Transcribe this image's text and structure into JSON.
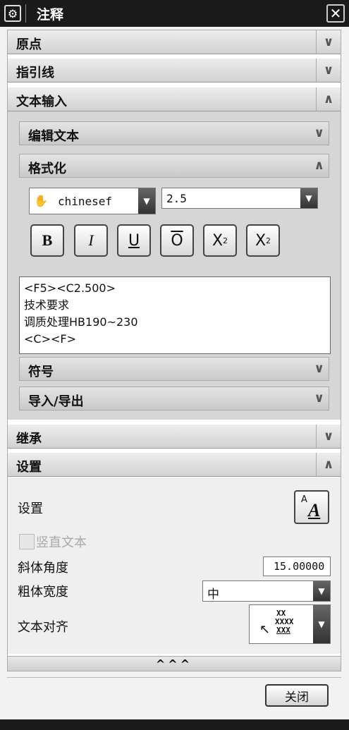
{
  "window": {
    "title": "注释",
    "close_glyph": "✕"
  },
  "sections": {
    "origin": "原点",
    "leader": "指引线",
    "text_input": "文本输入",
    "inherit": "继承",
    "settings": "设置"
  },
  "text_input": {
    "edit_text": "编辑文本",
    "format": "格式化",
    "symbols": "符号",
    "import_export": "导入/导出",
    "font_name": "chinesef",
    "font_size": "2.5",
    "format_buttons": {
      "bold": "B",
      "italic": "I",
      "underline": "U",
      "overline": "O",
      "superscript": "X",
      "superscript_mark": "2",
      "subscript": "X",
      "subscript_mark": "2"
    },
    "editor_lines": [
      "<F5><C2.500>",
      "技术要求",
      "调质处理HB190~230",
      "<C><F>"
    ]
  },
  "settings": {
    "label": "设置",
    "vertical_text": "竖直文本",
    "slant_angle_label": "斜体角度",
    "slant_angle_value": "15.00000",
    "bold_width_label": "粗体宽度",
    "bold_width_value": "中",
    "text_align_label": "文本对齐",
    "align_lines": [
      "XX",
      "XXXX",
      "XXX"
    ]
  },
  "footer": {
    "collapse_glyph": "^^^",
    "close_button": "关闭"
  },
  "icons": {
    "gear": "gear-icon",
    "chevron_down": "chevron-down-icon",
    "chevron_up": "chevron-up-icon"
  }
}
